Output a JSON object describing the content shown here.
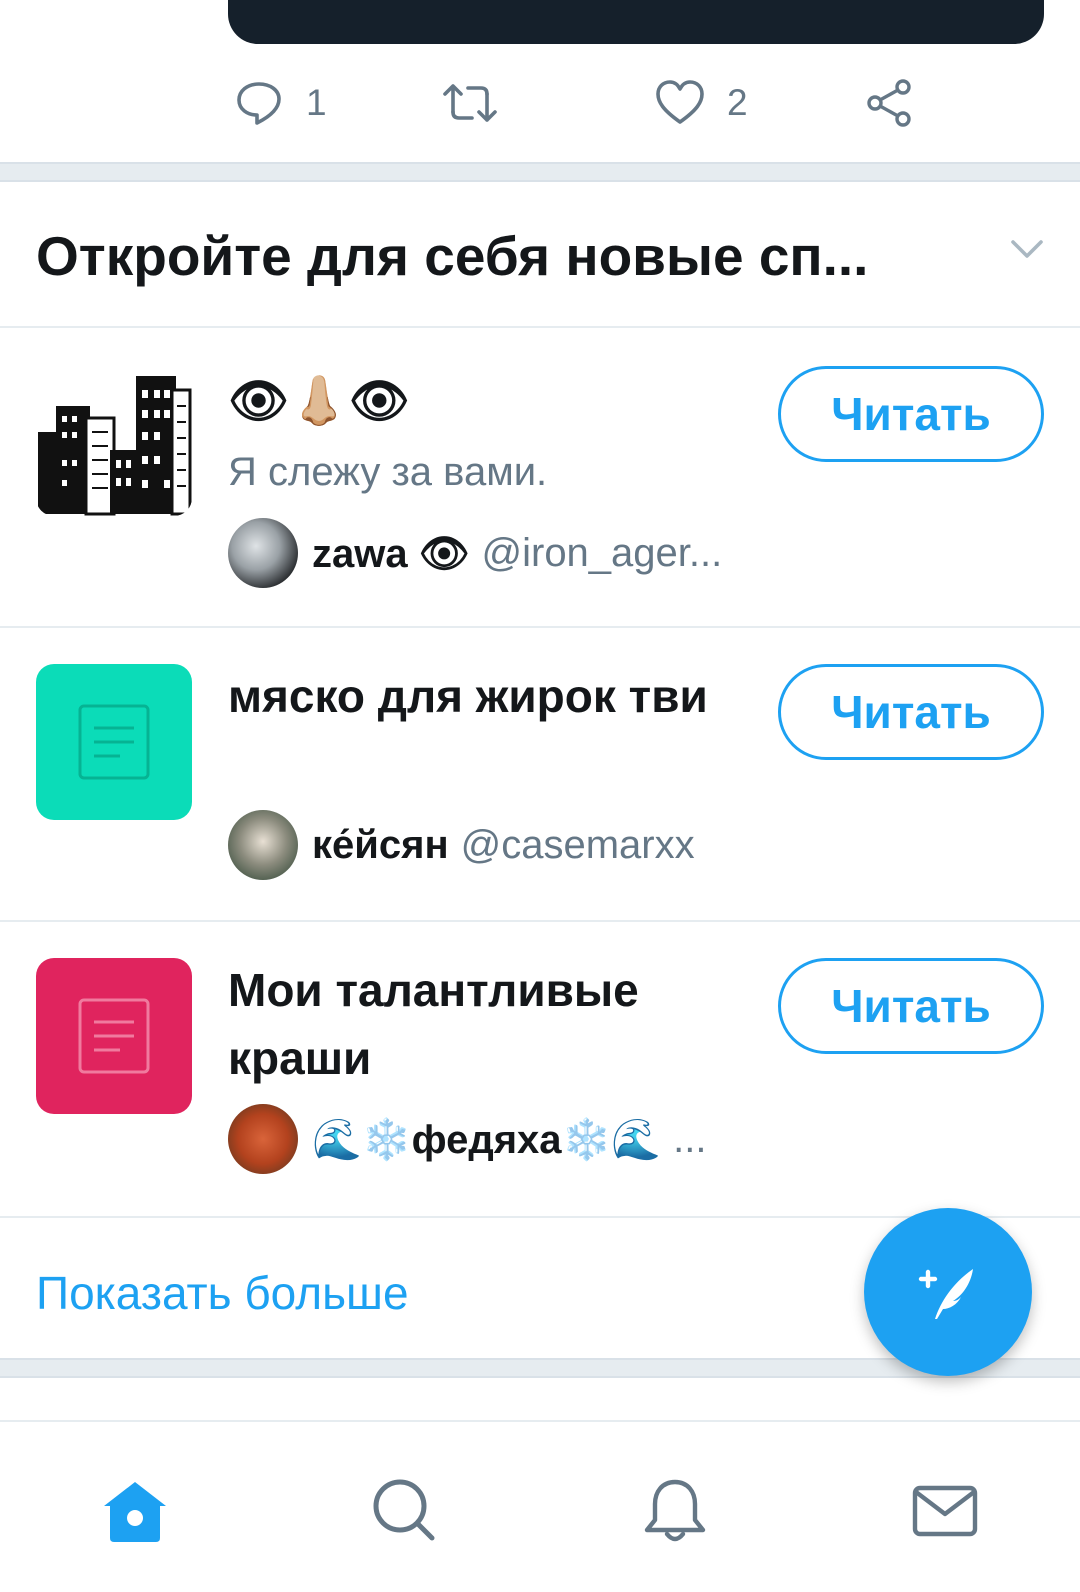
{
  "tweet_actions": {
    "reply_count": "1",
    "retweet_count": "",
    "like_count": "2"
  },
  "discover": {
    "title": "Откройте для себя новые сп..."
  },
  "lists": [
    {
      "title": "👁👃🏼👁",
      "description": "Я слежу за вами.",
      "owner_name": "zawa 👁",
      "owner_handle": "@iron_ager...",
      "follow_label": "Читать",
      "thumb_color": "#ffffff"
    },
    {
      "title": "мяско для жирок тви",
      "description": "",
      "owner_name": "ке́йсян",
      "owner_handle": "@casemarxx",
      "follow_label": "Читать",
      "thumb_color": "#0bdcb8"
    },
    {
      "title": "Мои талантливые краши",
      "description": "",
      "owner_name": "🌊❄️федяха❄️🌊",
      "owner_handle": "...",
      "follow_label": "Читать",
      "thumb_color": "#e0245e"
    }
  ],
  "show_more_label": "Показать больше",
  "colors": {
    "accent": "#1da1f2",
    "text_primary": "#14171a",
    "text_secondary": "#657786",
    "divider": "#e6ecf0"
  },
  "icons": {
    "reply": "reply-icon",
    "retweet": "retweet-icon",
    "like": "heart-icon",
    "share": "share-icon",
    "compose": "compose-tweet-icon",
    "home": "home-icon",
    "search": "search-icon",
    "notifications": "bell-icon",
    "messages": "envelope-icon"
  }
}
